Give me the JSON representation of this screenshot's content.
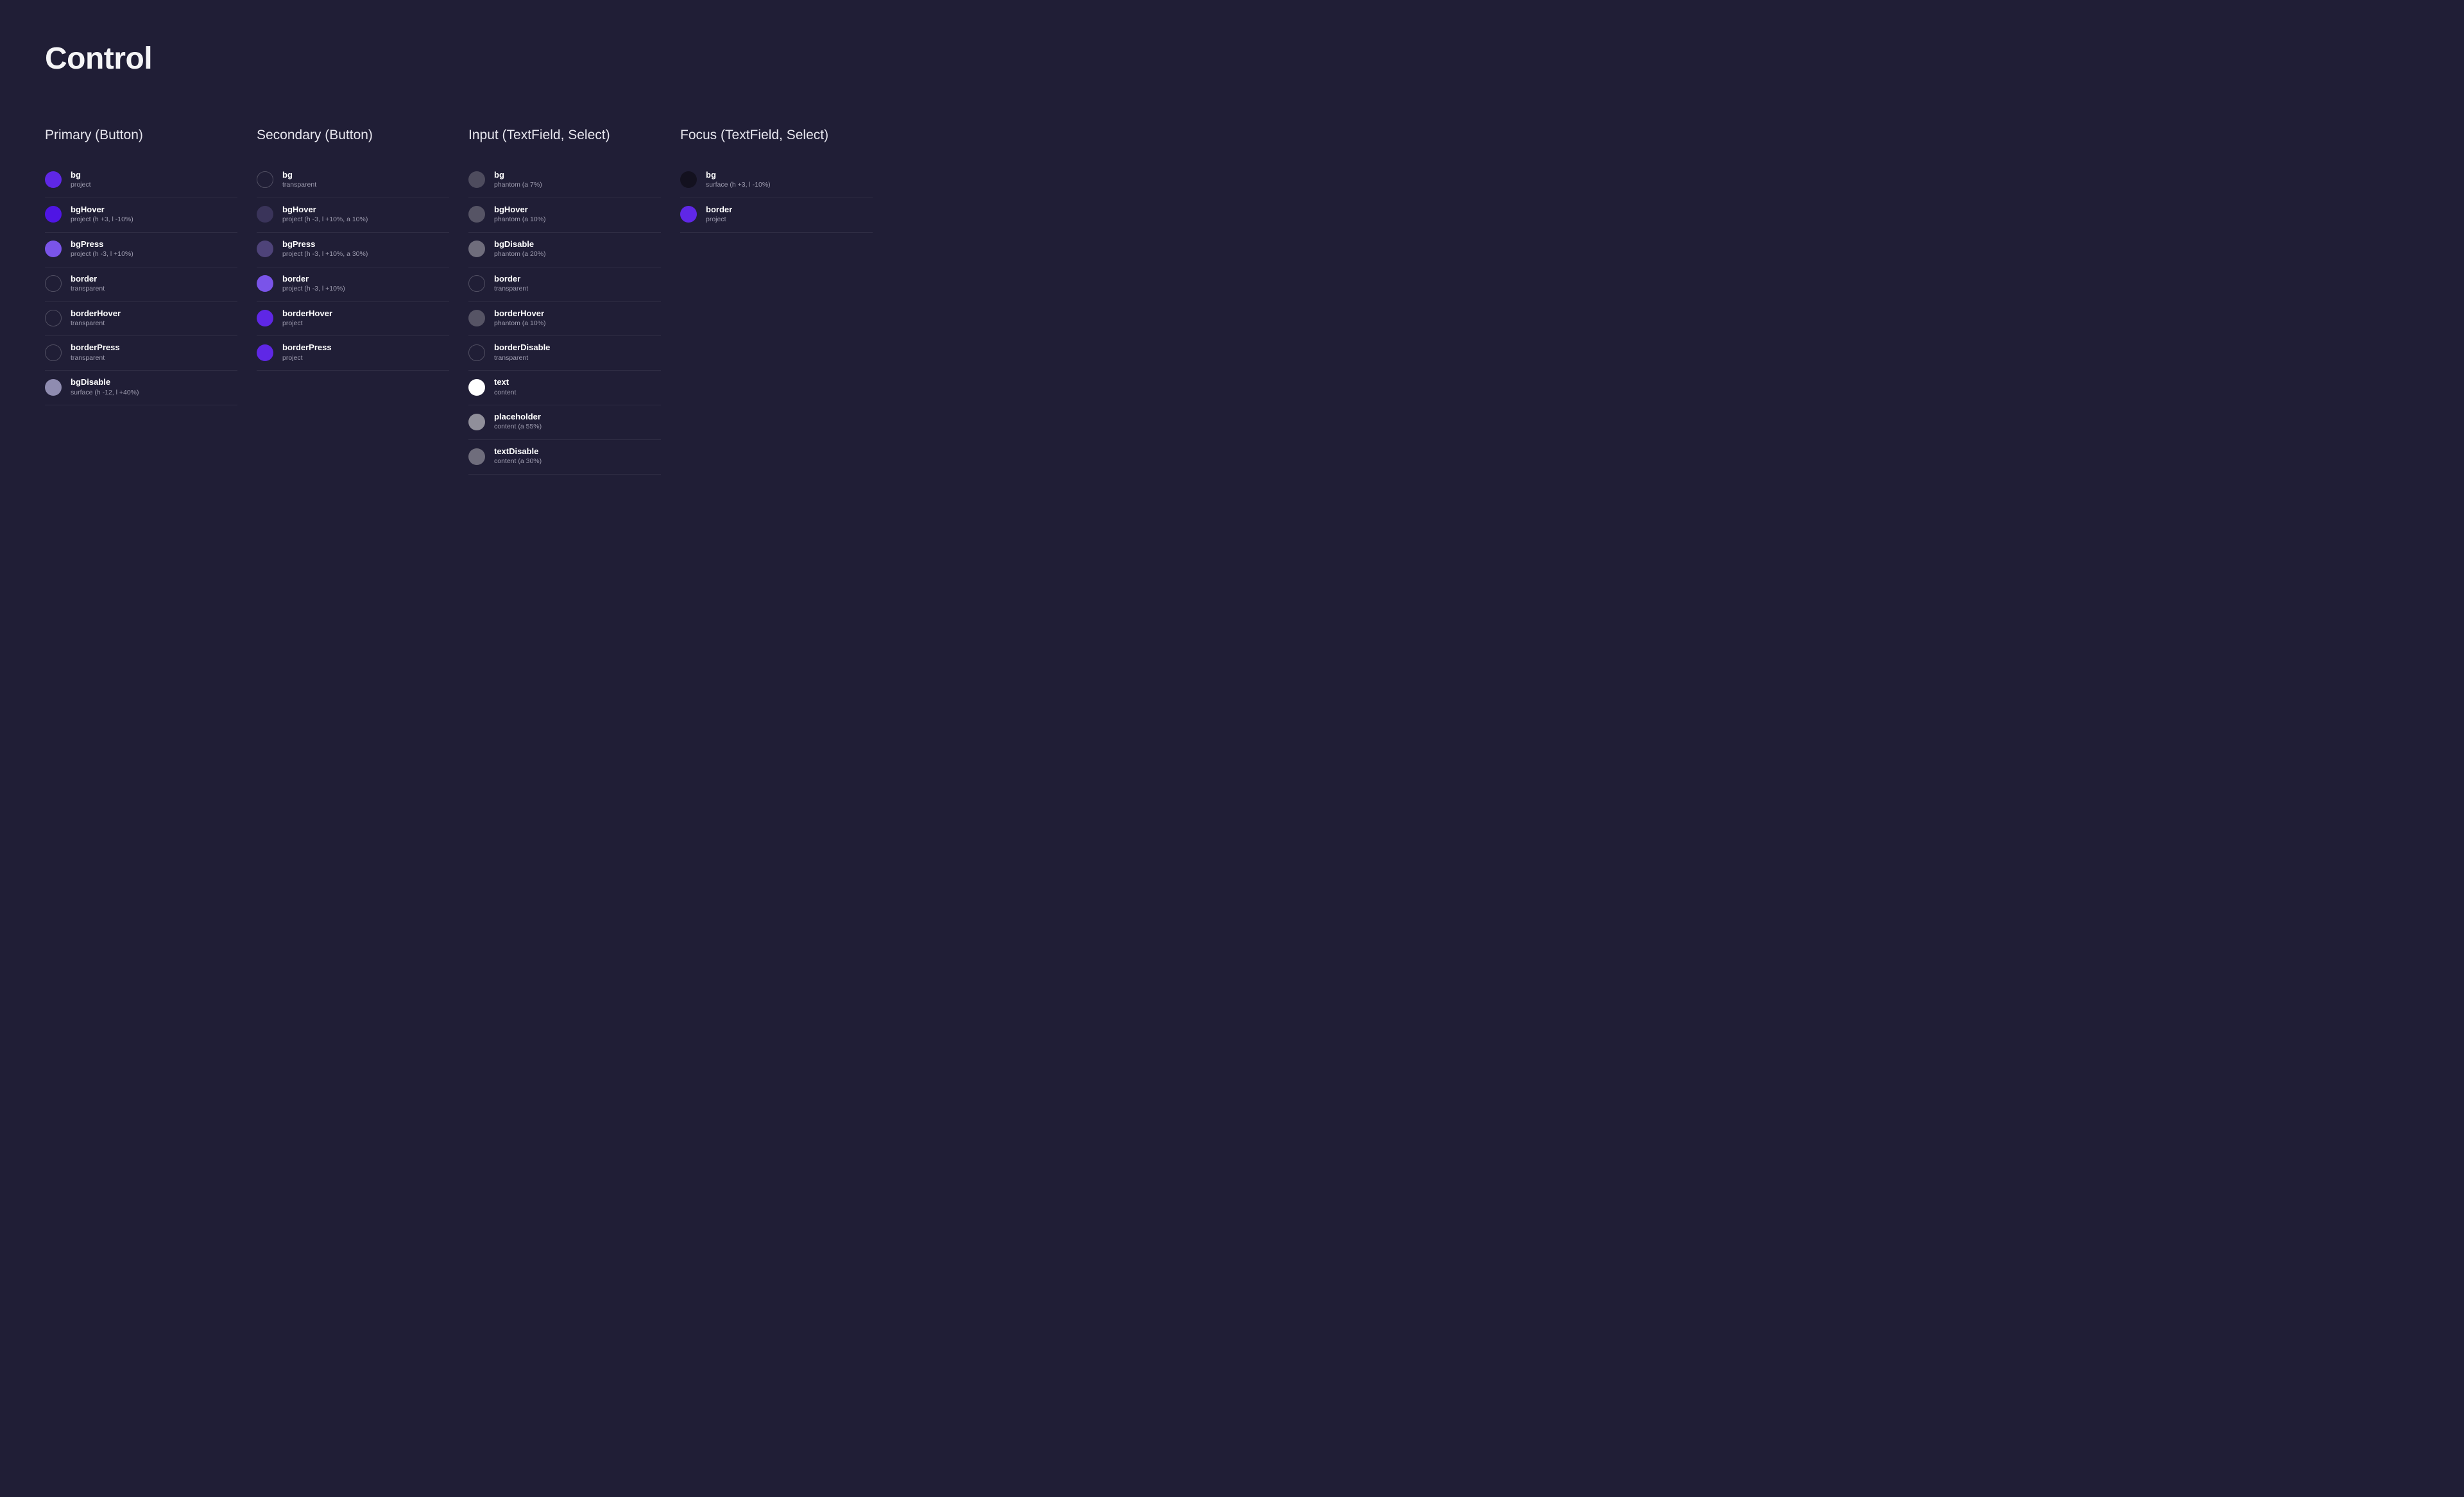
{
  "title": "Control",
  "sections": [
    {
      "heading": "Primary (Button)",
      "tokens": [
        {
          "name": "bg",
          "desc": "project",
          "color": "#5f27e6",
          "transparent": false
        },
        {
          "name": "bgHover",
          "desc": "project (h +3, l -10%)",
          "color": "#4f15e4",
          "transparent": false
        },
        {
          "name": "bgPress",
          "desc": "project (h -3, l +10%)",
          "color": "#7a54e9",
          "transparent": false
        },
        {
          "name": "border",
          "desc": "transparent",
          "color": "",
          "transparent": true
        },
        {
          "name": "borderHover",
          "desc": "transparent",
          "color": "",
          "transparent": true
        },
        {
          "name": "borderPress",
          "desc": "transparent",
          "color": "",
          "transparent": true
        },
        {
          "name": "bgDisable",
          "desc": "surface (h -12, l +40%)",
          "color": "#8f8cb0",
          "transparent": false
        }
      ]
    },
    {
      "heading": "Secondary (Button)",
      "tokens": [
        {
          "name": "bg",
          "desc": "transparent",
          "color": "",
          "transparent": true
        },
        {
          "name": "bgHover",
          "desc": "project (h -3, l +10%, a 10%)",
          "color": "#3a345a",
          "transparent": false
        },
        {
          "name": "bgPress",
          "desc": "project (h -3, l +10%, a 30%)",
          "color": "#4e4379",
          "transparent": false
        },
        {
          "name": "border",
          "desc": "project (h -3, l +10%)",
          "color": "#7a54e9",
          "transparent": false
        },
        {
          "name": "borderHover",
          "desc": "project",
          "color": "#5f27e6",
          "transparent": false
        },
        {
          "name": "borderPress",
          "desc": "project",
          "color": "#5f27e6",
          "transparent": false
        }
      ]
    },
    {
      "heading": "Input (TextField, Select)",
      "tokens": [
        {
          "name": "bg",
          "desc": "phantom (a 7%)",
          "color": "#4e4c5e",
          "transparent": false
        },
        {
          "name": "bgHover",
          "desc": "phantom (a 10%)",
          "color": "#565465",
          "transparent": false
        },
        {
          "name": "bgDisable",
          "desc": "phantom (a 20%)",
          "color": "#6f6d7c",
          "transparent": false
        },
        {
          "name": "border",
          "desc": "transparent",
          "color": "",
          "transparent": true
        },
        {
          "name": "borderHover",
          "desc": "phantom (a 10%)",
          "color": "#565465",
          "transparent": false
        },
        {
          "name": "borderDisable",
          "desc": "transparent",
          "color": "",
          "transparent": true
        },
        {
          "name": "text",
          "desc": "content",
          "color": "#ffffff",
          "transparent": false
        },
        {
          "name": "placeholder",
          "desc": "content (a 55%)",
          "color": "#908f9a",
          "transparent": false
        },
        {
          "name": "textDisable",
          "desc": "content (a 30%)",
          "color": "#6f6d7c",
          "transparent": false
        }
      ]
    },
    {
      "heading": "Focus (TextField, Select)",
      "tokens": [
        {
          "name": "bg",
          "desc": "surface (h +3, l -10%)",
          "color": "#13111f",
          "transparent": false
        },
        {
          "name": "border",
          "desc": "project",
          "color": "#5f27e6",
          "transparent": false
        }
      ]
    }
  ]
}
